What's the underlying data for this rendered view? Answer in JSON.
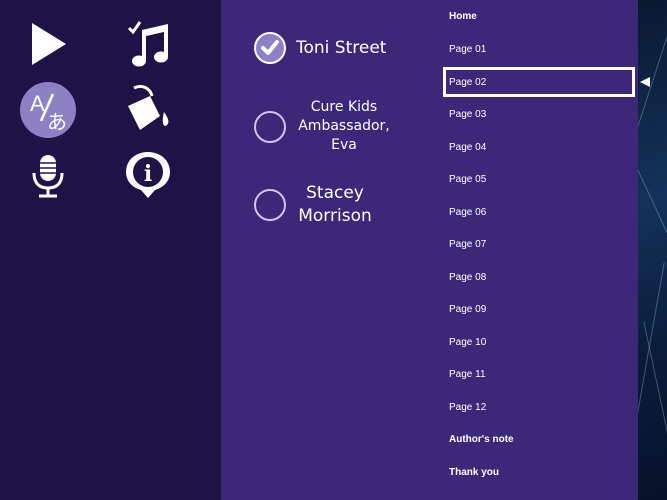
{
  "toolbar": {
    "items": [
      {
        "name": "play-icon"
      },
      {
        "name": "music-icon"
      },
      {
        "name": "translate-icon",
        "text_a": "A",
        "text_b": "あ"
      },
      {
        "name": "paint-bucket-icon"
      },
      {
        "name": "microphone-icon"
      },
      {
        "name": "info-icon",
        "text": "i"
      }
    ]
  },
  "options": [
    {
      "label": "Toni Street",
      "selected": true
    },
    {
      "label": "Cure Kids Ambassador, Eva",
      "line1": "Cure Kids",
      "line2": "Ambassador,",
      "line3": "Eva",
      "selected": false
    },
    {
      "label": "Stacey Morrison",
      "line1": "Stacey",
      "line2": "Morrison",
      "selected": false
    }
  ],
  "nav": {
    "items": [
      {
        "label": "Home"
      },
      {
        "label": "Page 01"
      },
      {
        "label": "Page 02"
      },
      {
        "label": "Page 03"
      },
      {
        "label": "Page 04"
      },
      {
        "label": "Page 05"
      },
      {
        "label": "Page 06"
      },
      {
        "label": "Page 07"
      },
      {
        "label": "Page 08"
      },
      {
        "label": "Page 09"
      },
      {
        "label": "Page 10"
      },
      {
        "label": "Page 11"
      },
      {
        "label": "Page 12"
      },
      {
        "label": "Author's note"
      },
      {
        "label": "Thank you"
      }
    ],
    "selected": "Page 02"
  },
  "colors": {
    "left_panel": "#1f1247",
    "main_panel": "#3c2778",
    "icon": "#ffffff",
    "translate_bg": "#8e80c4"
  }
}
